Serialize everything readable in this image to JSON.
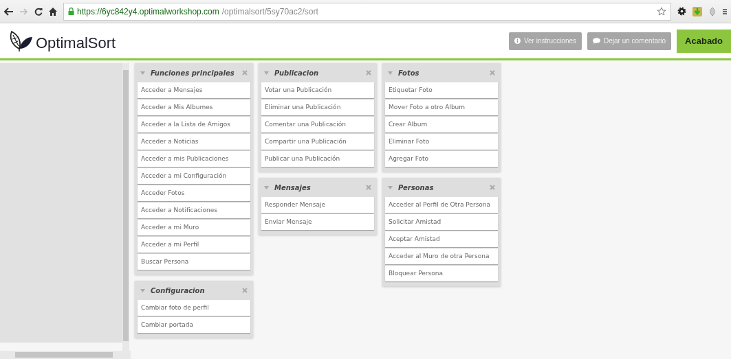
{
  "browser": {
    "url_host": "https://6yc842y4.optimalworkshop.com",
    "url_path": "/optimalsort/5sy70ac2/sort"
  },
  "header": {
    "logo": "OptimalSort",
    "buttons": [
      {
        "kind": "info",
        "label": "Ver instrucciones"
      },
      {
        "kind": "comment",
        "label": "Dejar un comentario"
      },
      {
        "kind": "primary",
        "label": "Acabado"
      }
    ]
  },
  "columns": [
    [
      {
        "title": "Funciones principales",
        "cards": [
          "Acceder a Mensajes",
          "Acceder a Mis Albumes",
          "Acceder a la Lista de Amigos",
          "Acceder a Noticias",
          "Acceder a mis Publicaciones",
          "Acceder a mi Configuración",
          "Acceder Fotos",
          "Acceder a Notificaciones",
          "Acceder a mi Muro",
          "Acceder a mi Perfil",
          "Buscar Persona"
        ]
      },
      {
        "title": "Configuracion",
        "cards": [
          "Cambiar foto de perfil",
          "Cambiar portada"
        ]
      }
    ],
    [
      {
        "title": "Publicacion",
        "cards": [
          "Votar una Publicación",
          "Eliminar una Publicación",
          "Comentar una Publicación",
          "Compartir una Publicación",
          "Publicar una Publicación"
        ]
      },
      {
        "title": "Mensajes",
        "cards": [
          "Responder Mensaje",
          "Enviar Mensaje"
        ]
      }
    ],
    [
      {
        "title": "Fotos",
        "cards": [
          "Etiquetar Foto",
          "Mover Foto a otro Album",
          "Crear Album",
          "Eliminar Foto",
          "Agregar Foto"
        ]
      },
      {
        "title": "Personas",
        "cards": [
          "Acceder al Perfil de Otra Persona",
          "Solicitar Amistad",
          "Aceptar Amistad",
          "Acceder al Muro de otra Persona",
          "Bloquear Persona"
        ]
      }
    ]
  ]
}
